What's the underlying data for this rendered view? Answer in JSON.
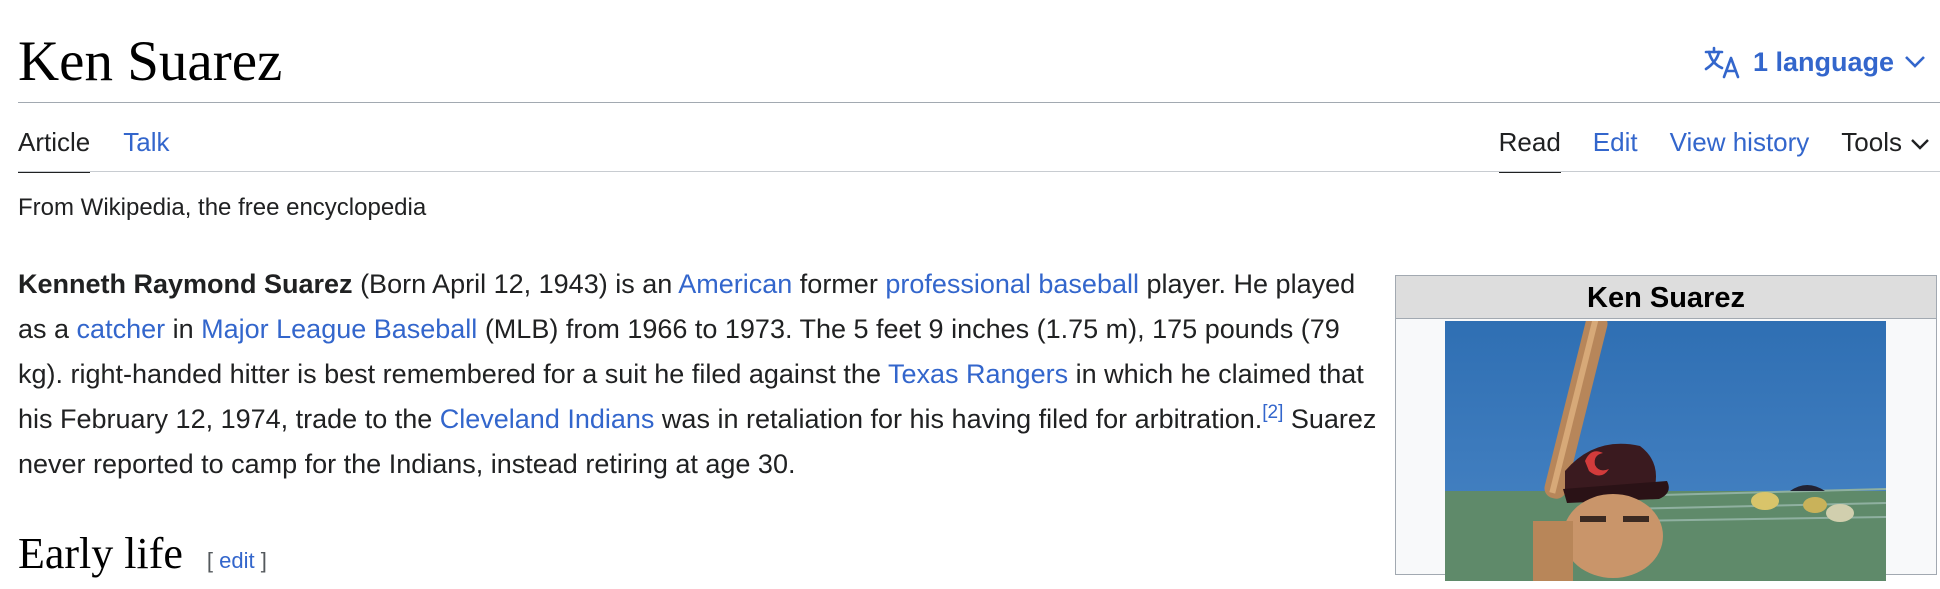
{
  "header": {
    "title": "Ken Suarez",
    "language_button": "1 language"
  },
  "tabs": {
    "left": [
      "Article",
      "Talk"
    ],
    "right": [
      "Read",
      "Edit",
      "View history",
      "Tools"
    ]
  },
  "tagline": "From Wikipedia, the free encyclopedia",
  "lead": {
    "name": "Kenneth Raymond Suarez",
    "t1": " (Born April 12, 1943) is an ",
    "link_american": "American",
    "t2": " former ",
    "link_pro_baseball": "professional baseball",
    "t3": " player. He played as a ",
    "link_catcher": "catcher",
    "t4": " in ",
    "link_mlb": "Major League Baseball",
    "t5": " (MLB) from 1966 to 1973. The 5 feet 9 inches (1.75 m), 175 pounds (79 kg). right-handed hitter is best remembered for a suit he filed against the ",
    "link_rangers": "Texas Rangers",
    "t6": " in which he claimed that his February 12, 1974, trade to the ",
    "link_indians": "Cleveland Indians",
    "t7": " was in retaliation for his having filed for arbitration.",
    "citation": "[2]",
    "t8": " Suarez never reported to camp for the Indians, instead retiring at age 30."
  },
  "section": {
    "heading": "Early life",
    "edit_open": "[ ",
    "edit_label": "edit",
    "edit_close": " ]"
  },
  "infobox": {
    "title": "Ken Suarez",
    "image_caption_icon": "player-photo"
  },
  "colors": {
    "link": "#3366cc",
    "text": "#202122",
    "infobox_header": "#dddddd"
  }
}
